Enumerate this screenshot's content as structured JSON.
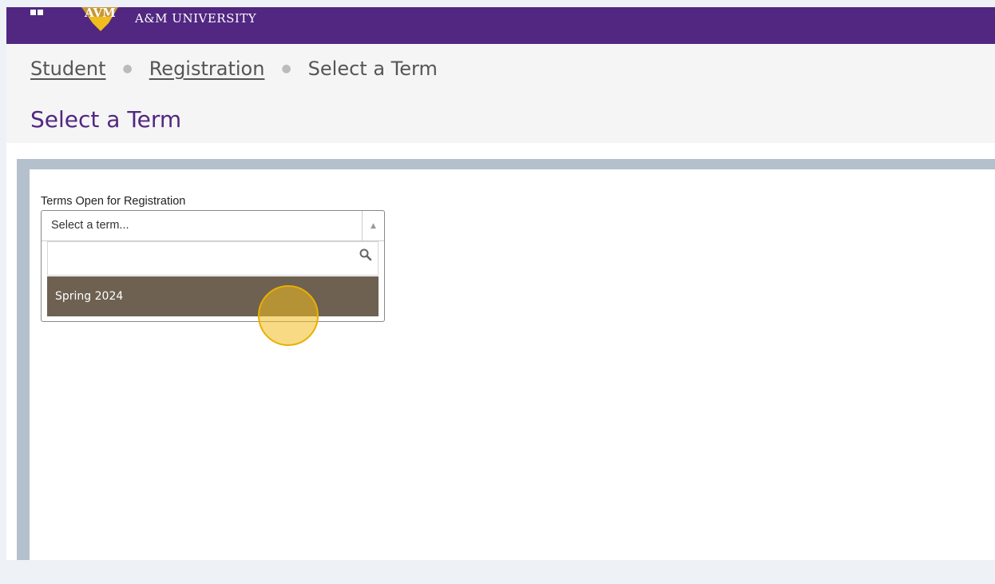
{
  "header": {
    "brand": "A&M UNIVERSITY",
    "logo_text": "AVM",
    "colors": {
      "primary": "#512781",
      "gold": "#f1bc1e"
    }
  },
  "breadcrumb": {
    "items": [
      "Student",
      "Registration",
      "Select a Term"
    ]
  },
  "page": {
    "title": "Select a Term"
  },
  "term_selector": {
    "label": "Terms Open for Registration",
    "selected_value": "Select a term...",
    "search_value": "",
    "options": [
      "Spring 2024"
    ],
    "highlighted_option_color": "#6e6152"
  }
}
